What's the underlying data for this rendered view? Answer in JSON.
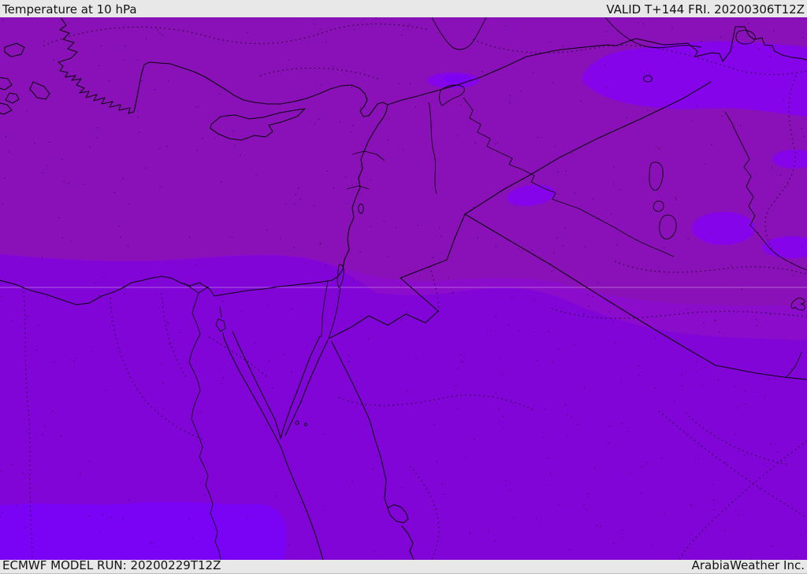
{
  "header": {
    "title": "Temperature at 10 hPa",
    "valid_time": "VALID T+144 FRI. 20200306T12Z"
  },
  "footer": {
    "model_run": "ECMWF MODEL RUN: 20200229T12Z",
    "credit": "ArabiaWeather Inc."
  },
  "map": {
    "colors": {
      "bar_background": "#e8e8e8",
      "bar_text": "#131313",
      "north_band": "#8a11b7",
      "transition_band": "#8c0ccb",
      "south_region": "#8205d8",
      "cold_pocket": "#8604e9",
      "cold_pocket_core": "#7d02f2",
      "coldest_patch": "#7a02f5",
      "coastline": "#0d0112",
      "graticule_line": "#e3c3ef"
    },
    "features": [
      "aegean-islands",
      "turkey-coastline",
      "cyprus",
      "levant-coastline",
      "nile-delta",
      "nile-river",
      "suez-canal",
      "sinai-peninsula",
      "gulf-of-suez",
      "gulf-of-aqaba",
      "red-sea",
      "dead-sea",
      "sea-of-galilee",
      "lake-assad",
      "euphrates-river",
      "tigris-river",
      "lake-tharthar",
      "lake-habbaniyah",
      "lake-razzaza",
      "lake-van",
      "country-borders",
      "province-borders-dotted",
      "latitude-gridline"
    ]
  }
}
